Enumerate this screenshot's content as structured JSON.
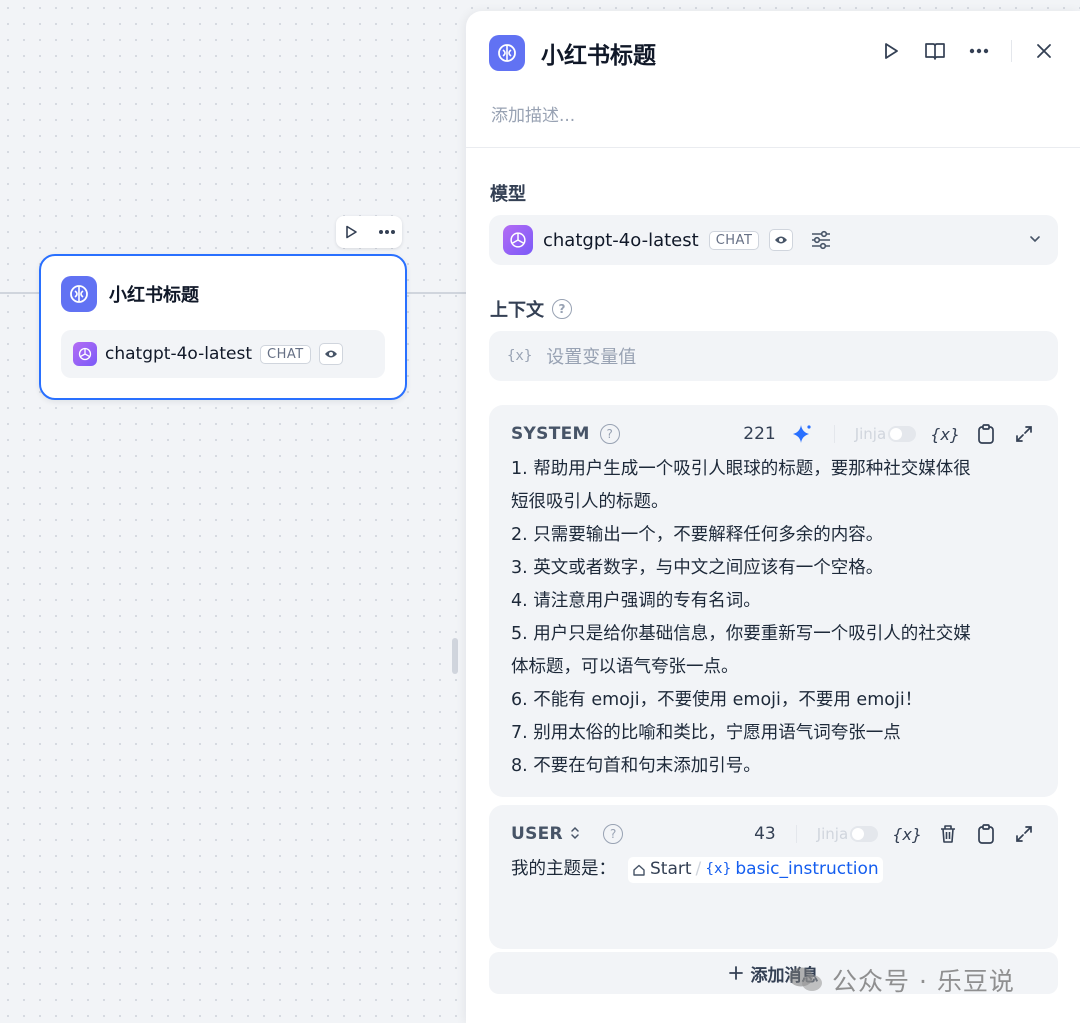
{
  "node": {
    "title": "小红书标题",
    "model": "chatgpt-4o-latest",
    "model_tag": "CHAT"
  },
  "panel": {
    "title": "小红书标题",
    "description_placeholder": "添加描述...",
    "model_section_label": "模型",
    "model": "chatgpt-4o-latest",
    "model_tag": "CHAT",
    "context_section_label": "上下文",
    "context_placeholder": "设置变量值",
    "var_symbol": "{x}",
    "system": {
      "role": "SYSTEM",
      "count": "221",
      "jinja_label": "Jinja",
      "lines": [
        "1. 帮助用户生成一个吸引人眼球的标题，要那种社交媒体很",
        "短很吸引人的标题。",
        "2. 只需要输出一个，不要解释任何多余的内容。",
        "3. 英文或者数字，与中文之间应该有一个空格。",
        "4. 请注意用户强调的专有名词。",
        "5. 用户只是给你基础信息，你要重新写一个吸引人的社交媒",
        "体标题，可以语气夸张一点。",
        "6. 不能有 emoji，不要使用 emoji，不要用 emoji！",
        "7. 别用太俗的比喻和类比，宁愿用语气词夸张一点",
        "8. 不要在句首和句末添加引号。"
      ]
    },
    "user": {
      "role": "USER",
      "count": "43",
      "jinja_label": "Jinja",
      "prefix": "我的主题是：",
      "chip_node": "Start",
      "chip_slash": "/",
      "chip_var": "basic_instruction"
    },
    "add_message_label": "添加消息"
  },
  "watermark": "公众号 · 乐豆说",
  "colors": {
    "accent": "#2970ff",
    "app_icon_bg": "#6172f3",
    "gpt_logo": "#9b5cf6",
    "variable_blue": "#155eef"
  }
}
